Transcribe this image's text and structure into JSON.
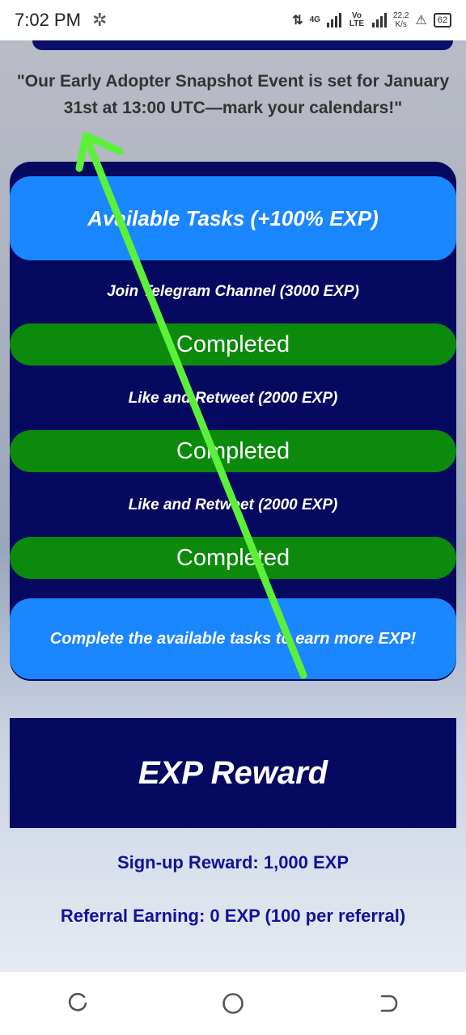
{
  "status_bar": {
    "time": "7:02 PM",
    "network_4g": "4G",
    "volte": "Vo LTE",
    "speed_value": "22.2",
    "speed_unit": "K/s",
    "battery": "62",
    "icons": [
      "settings-gear-icon",
      "data-transfer-icon",
      "signal-icon",
      "warning-icon",
      "battery-icon"
    ]
  },
  "announcement": "\"Our Early Adopter Snapshot Event is set for January 31st at 13:00 UTC—mark your calendars!\"",
  "tasks": {
    "header": "Available Tasks (+100% EXP)",
    "items": [
      {
        "label": "Join Telegram Channel (3000 EXP)",
        "status": "Completed"
      },
      {
        "label": "Like and Retweet (2000 EXP)",
        "status": "Completed"
      },
      {
        "label": "Like and Retweet (2000 EXP)",
        "status": "Completed"
      }
    ],
    "footer": "Complete the available tasks to earn more EXP!"
  },
  "reward": {
    "title": "EXP Reward",
    "signup": "Sign-up Reward: 1,000 EXP",
    "referral": "Referral Earning: 0 EXP (100 per referral)"
  },
  "colors": {
    "dark_navy": "#05095f",
    "accent_blue": "#1a86ff",
    "completed_green": "#0c8a0c",
    "reward_text": "#12129a",
    "annotation_arrow": "#5cf03a"
  },
  "nav": {
    "icons": [
      "recent-apps-icon",
      "home-icon",
      "back-icon"
    ]
  }
}
